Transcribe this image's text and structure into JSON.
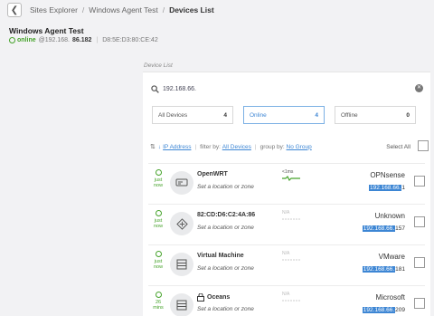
{
  "breadcrumb": {
    "items": [
      "Sites Explorer",
      "Windows Agent Test"
    ],
    "current": "Devices List"
  },
  "agent": {
    "title": "Windows Agent Test",
    "status": "online",
    "ip_prefix": "@192.168.",
    "ip_suffix": "86.182",
    "mac": "D8:5E:D3:80:CE:42"
  },
  "section_label": "Device List",
  "search": {
    "value": "192.168.66."
  },
  "filters": [
    {
      "label": "All Devices",
      "count": "4"
    },
    {
      "label": "Online",
      "count": "4"
    },
    {
      "label": "Offline",
      "count": "0"
    }
  ],
  "sort": {
    "field": "IP Address",
    "filter_label": "filter by:",
    "filter_value": "All Devices",
    "group_label": "group by:",
    "group_value": "No Group",
    "select_all": "Select All"
  },
  "devices": [
    {
      "name": "OpenWRT",
      "location": "Set a location or zone",
      "status": "just now",
      "latency": "<1ms",
      "vendor": "OPNsense",
      "ip_hl": "192.168.66.",
      "ip_rest": "1",
      "icon": "router-icon"
    },
    {
      "name": "82:CD:D6:C2:4A:86",
      "location": "Set a location or zone",
      "status": "just now",
      "latency": "N/A",
      "vendor": "Unknown",
      "ip_hl": "192.168.66.",
      "ip_rest": "157",
      "icon": "network-node-icon"
    },
    {
      "name": "Virtual Machine",
      "location": "Set a location or zone",
      "status": "just now",
      "latency": "N/A",
      "vendor": "VMware",
      "ip_hl": "192.168.66.",
      "ip_rest": "181",
      "icon": "server-icon"
    },
    {
      "name": "Oceans",
      "location": "Set a location or zone",
      "status": "26 mins",
      "latency": "N/A",
      "vendor": "Microsoft",
      "ip_hl": "192.168.66.",
      "ip_rest": "209",
      "icon": "server-icon"
    }
  ],
  "colors": {
    "accent": "#3d86d4",
    "online": "#46a32b",
    "background": "#f2f2f4"
  }
}
